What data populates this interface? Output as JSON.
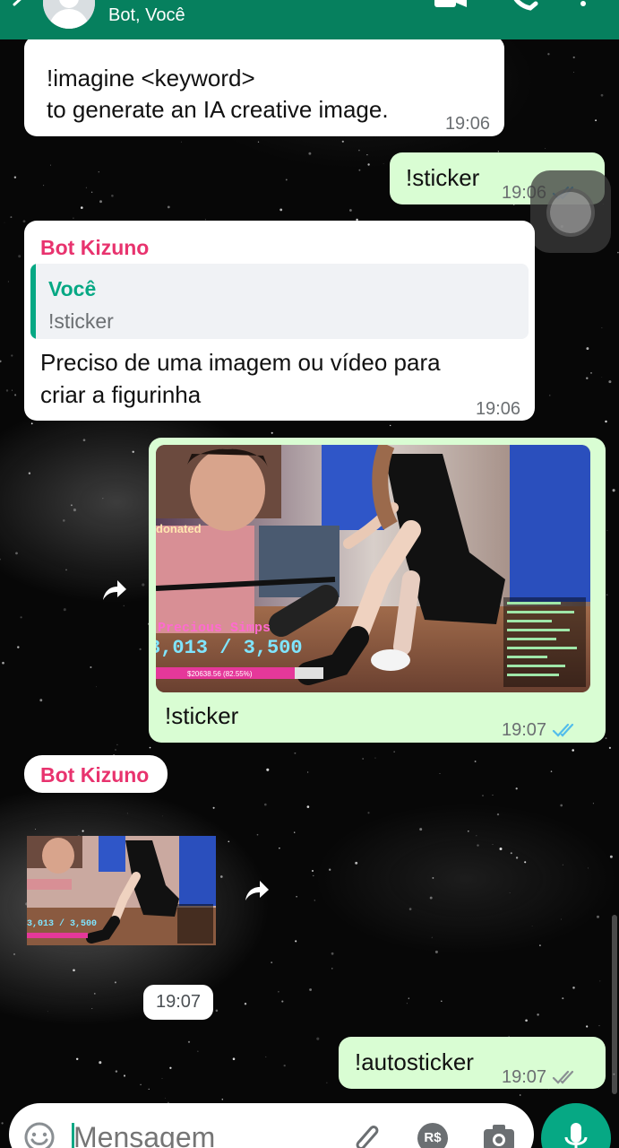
{
  "header": {
    "subtitle": "Bot, Você"
  },
  "messages": {
    "m1": {
      "line1": "!imagine <keyword>",
      "line2": "to generate an IA creative image.",
      "time": "19:06"
    },
    "m2": {
      "text": "!sticker",
      "time": "19:06"
    },
    "m3": {
      "sender": "Bot Kizuno",
      "quote_name": "Você",
      "quote_text": "!sticker",
      "line1": "Preciso de uma imagem ou vídeo para",
      "line2": "criar a figurinha",
      "time": "19:06"
    },
    "m4": {
      "caption": "!sticker",
      "time": "19:07",
      "overlay": {
        "donated": "donated",
        "goal_title": "Precious Simps",
        "goal_value": "3,013 / 3,500",
        "bar_text": "$20638.56 (82.55%)"
      }
    },
    "m5": {
      "sender": "Bot Kizuno",
      "time": "19:07"
    },
    "m6": {
      "text": "!autosticker",
      "time": "19:07"
    }
  },
  "input": {
    "placeholder": "Mensagem",
    "payment_icon_label": "R$"
  },
  "colors": {
    "header": "#06805e",
    "outgoing_bubble": "#d9fdd3",
    "incoming_bubble": "#ffffff",
    "sender_name": "#e8336e",
    "quote_accent": "#06a884",
    "read_ticks": "#53bdeb",
    "sent_ticks": "#8a8f93"
  },
  "icons": [
    "back-arrow-icon",
    "video-call-icon",
    "phone-icon",
    "more-options-icon",
    "forward-icon",
    "emoji-icon",
    "attach-icon",
    "payment-icon",
    "camera-icon",
    "mic-icon"
  ]
}
